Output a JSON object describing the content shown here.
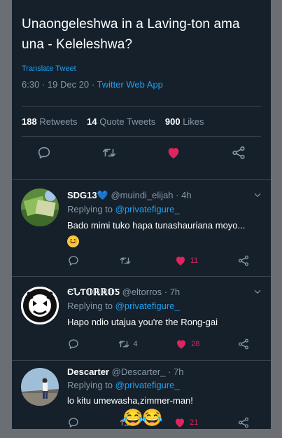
{
  "tweet": {
    "text": "Unaongeleshwa in a Laving-ton ama una - Keleleshwa?",
    "translate_label": "Translate Tweet",
    "time": "6:30",
    "date": "19 Dec 20",
    "app": "Twitter Web App",
    "retweets_count": "188",
    "retweets_label": "Retweets",
    "quotes_count": "14",
    "quotes_label": "Quote Tweets",
    "likes_count": "900",
    "likes_label": "Likes",
    "liked": true
  },
  "replies": [
    {
      "name": "SDG13",
      "verified_emoji": "💙",
      "handle": "@muindi_elijah",
      "time": "4h",
      "replying_label": "Replying to",
      "replying_to": "@privatefigure_",
      "text": "Bado mimi tuko hapa tunashauriana moyo...",
      "emoji": "😆",
      "retweets": "",
      "likes": "11",
      "liked": true
    },
    {
      "name": "ЄՆƬ𝕆ℝℝ𝕆Ƽ",
      "handle": "@eltorros",
      "time": "7h",
      "replying_label": "Replying to",
      "replying_to": "@privatefigure_",
      "text": "Hapo ndio utajua you're the Rong-gai",
      "retweets": "4",
      "likes": "28",
      "liked": true
    },
    {
      "name": "Descarter",
      "handle": "@Descarter_",
      "time": "7h",
      "replying_label": "Replying to",
      "replying_to": "@privatefigure_",
      "text": "lo kitu umewasha,zimmer-man!",
      "emoji": "😂😂",
      "retweets": "",
      "likes": "21",
      "liked": true
    }
  ],
  "colors": {
    "background": "#15202b",
    "accent": "#1da1f2",
    "like": "#e0245e",
    "muted": "#8899a6"
  },
  "icons": [
    "reply-icon",
    "retweet-icon",
    "heart-icon",
    "share-icon",
    "chevron-down-icon"
  ]
}
